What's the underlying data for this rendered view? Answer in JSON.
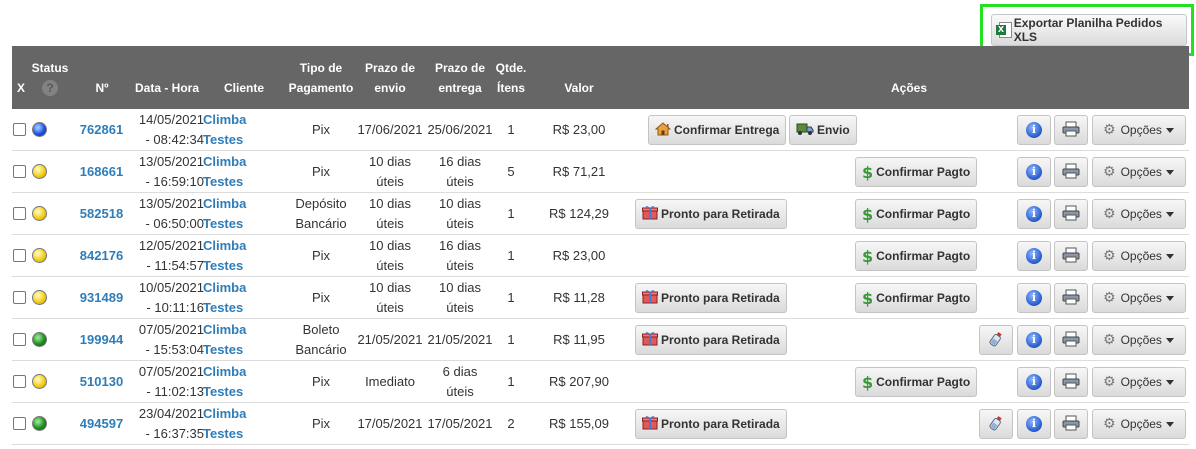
{
  "export_label": "Exportar Planilha Pedidos XLS",
  "headers": {
    "x": "X",
    "status": "Status",
    "help": "?",
    "num": "Nº",
    "datahora": "Data - Hora",
    "cliente": "Cliente",
    "tipo": [
      "Tipo de",
      "Pagamento"
    ],
    "envio": [
      "Prazo de",
      "envio"
    ],
    "entrega": [
      "Prazo de",
      "entrega"
    ],
    "qtde": [
      "Qtde.",
      "Ítens"
    ],
    "valor": "Valor",
    "acoes": "Ações"
  },
  "labels": {
    "confirmar_entrega": "Confirmar Entrega",
    "envio": "Envio",
    "confirmar_pagto": "Confirmar Pagto",
    "pronto_retirada": "Pronto para Retirada",
    "opcoes": "Opções",
    "info": "i"
  },
  "status_colors": {
    "blue": "#1a53e6",
    "yellow": "#f3cf1a",
    "green": "#1f8f1f"
  },
  "orders": [
    {
      "status": "blue",
      "num": "762861",
      "date": "14/05/2021",
      "time": "- 08:42:34",
      "cli1": "Climba",
      "cli2": "Testes",
      "tipo": [
        "Pix"
      ],
      "envio": [
        "17/06/2021"
      ],
      "entrega": [
        "25/06/2021"
      ],
      "qtde": "1",
      "valor": "R$ 23,00",
      "actions": [
        "confirmar_entrega",
        "envio"
      ]
    },
    {
      "status": "yellow",
      "num": "168661",
      "date": "13/05/2021",
      "time": "- 16:59:10",
      "cli1": "Climba",
      "cli2": "Testes",
      "tipo": [
        "Pix"
      ],
      "envio": [
        "10 dias",
        "úteis"
      ],
      "entrega": [
        "16 dias",
        "úteis"
      ],
      "qtde": "5",
      "valor": "R$ 71,21",
      "actions": [
        "confirmar_pagto"
      ]
    },
    {
      "status": "yellow",
      "num": "582518",
      "date": "13/05/2021",
      "time": "- 06:50:00",
      "cli1": "Climba",
      "cli2": "Testes",
      "tipo": [
        "Depósito",
        "Bancário"
      ],
      "envio": [
        "10 dias",
        "úteis"
      ],
      "entrega": [
        "10 dias",
        "úteis"
      ],
      "qtde": "1",
      "valor": "R$ 124,29",
      "actions": [
        "pronto_retirada",
        "confirmar_pagto"
      ]
    },
    {
      "status": "yellow",
      "num": "842176",
      "date": "12/05/2021",
      "time": "- 11:54:57",
      "cli1": "Climba",
      "cli2": "Testes",
      "tipo": [
        "Pix"
      ],
      "envio": [
        "10 dias",
        "úteis"
      ],
      "entrega": [
        "16 dias",
        "úteis"
      ],
      "qtde": "1",
      "valor": "R$ 23,00",
      "actions": [
        "confirmar_pagto"
      ]
    },
    {
      "status": "yellow",
      "num": "931489",
      "date": "10/05/2021",
      "time": "- 10:11:16",
      "cli1": "Climba",
      "cli2": "Testes",
      "tipo": [
        "Pix"
      ],
      "envio": [
        "10 dias",
        "úteis"
      ],
      "entrega": [
        "10 dias",
        "úteis"
      ],
      "qtde": "1",
      "valor": "R$ 11,28",
      "actions": [
        "pronto_retirada",
        "confirmar_pagto"
      ]
    },
    {
      "status": "green",
      "num": "199944",
      "date": "07/05/2021",
      "time": "- 15:53:04",
      "cli1": "Climba",
      "cli2": "Testes",
      "tipo": [
        "Boleto",
        "Bancário"
      ],
      "envio": [
        "21/05/2021"
      ],
      "entrega": [
        "21/05/2021"
      ],
      "qtde": "1",
      "valor": "R$ 11,95",
      "actions": [
        "pronto_retirada",
        "rastreio"
      ]
    },
    {
      "status": "yellow",
      "num": "510130",
      "date": "07/05/2021",
      "time": "- 11:02:13",
      "cli1": "Climba",
      "cli2": "Testes",
      "tipo": [
        "Pix"
      ],
      "envio": [
        "Imediato"
      ],
      "entrega": [
        "6 dias",
        "úteis"
      ],
      "qtde": "1",
      "valor": "R$ 207,90",
      "actions": [
        "confirmar_pagto"
      ]
    },
    {
      "status": "green",
      "num": "494597",
      "date": "23/04/2021",
      "time": "- 16:37:35",
      "cli1": "Climba",
      "cli2": "Testes",
      "tipo": [
        "Pix"
      ],
      "envio": [
        "17/05/2021"
      ],
      "entrega": [
        "17/05/2021"
      ],
      "qtde": "2",
      "valor": "R$ 155,09",
      "actions": [
        "pronto_retirada",
        "rastreio"
      ]
    }
  ]
}
